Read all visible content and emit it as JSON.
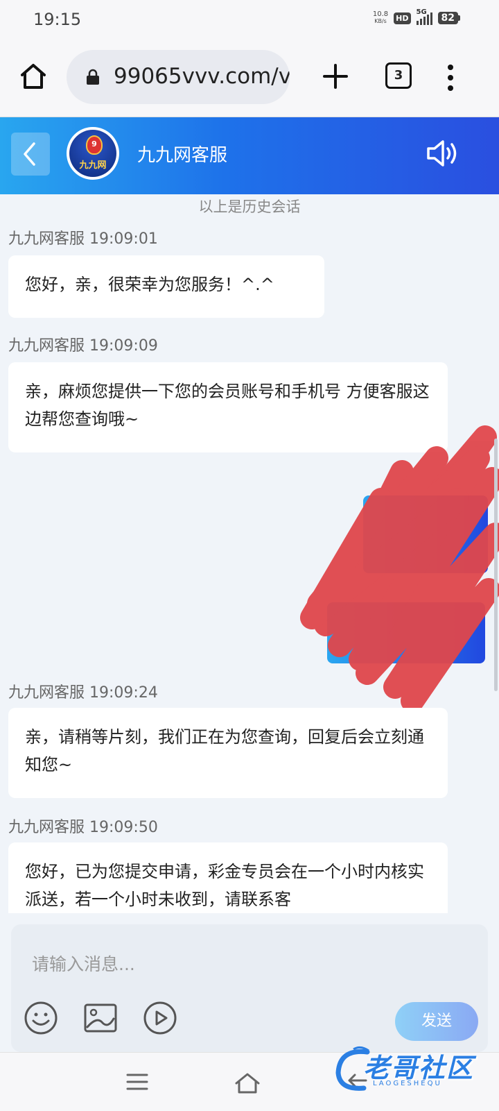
{
  "status_bar": {
    "time": "19:15",
    "net_speed_value": "10.8",
    "net_speed_unit": "KB/s",
    "hd_label": "HD",
    "network_type": "5G",
    "battery": "82"
  },
  "browser": {
    "url": "99065vvv.com/v",
    "tab_count": "3"
  },
  "chat_header": {
    "title": "九九网客服",
    "avatar_text": "九九网",
    "avatar_badge": "9"
  },
  "history_note": "以上是历史会话",
  "messages": [
    {
      "sender": "九九网客服",
      "time": "19:09:01",
      "text": "您好，亲，很荣幸为您服务！^.^"
    },
    {
      "sender": "九九网客服",
      "time": "19:09:09",
      "text": "亲，麻烦您提供一下您的会员账号和手机号  方便客服这边帮您查询哦~"
    },
    {
      "sender": "九九网客服",
      "time": "19:09:24",
      "text": "亲，请稍等片刻，我们正在为您查询，回复后会立刻通知您~"
    },
    {
      "sender": "九九网客服",
      "time": "19:09:50",
      "text": "您好，已为您提交申请，彩金专员会在一个小时内核实派送，若一个小时未收到，请联系客"
    }
  ],
  "input": {
    "placeholder": "请输入消息...",
    "send_label": "发送"
  },
  "watermark": {
    "text": "老哥社区",
    "sub": "LAOGESHEQU"
  },
  "colors": {
    "header_start": "#29a6ef",
    "header_end": "#2a4fe0",
    "scribble": "#e0474c",
    "send_button": "#8fbff5"
  },
  "icons": [
    "home-icon",
    "lock-icon",
    "plus-icon",
    "more-icon",
    "back-icon",
    "sound-icon",
    "emoji-icon",
    "image-icon",
    "video-icon",
    "nav-menu-icon",
    "nav-home-icon",
    "nav-back-icon"
  ]
}
